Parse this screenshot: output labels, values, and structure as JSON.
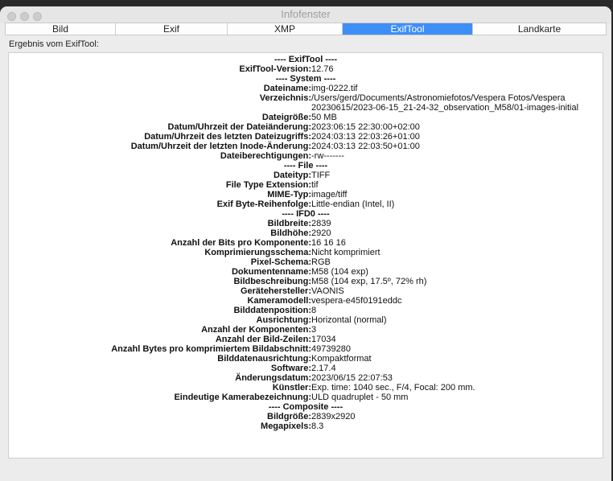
{
  "window": {
    "title": "Infofenster"
  },
  "tabs": [
    {
      "label": "Bild",
      "active": false
    },
    {
      "label": "Exif",
      "active": false
    },
    {
      "label": "XMP",
      "active": false
    },
    {
      "label": "ExifTool",
      "active": true
    },
    {
      "label": "Landkarte",
      "active": false
    }
  ],
  "panel": {
    "label": "Ergebnis vom ExifTool:"
  },
  "colors": {
    "accent": "#3d8ef7"
  },
  "rows": [
    {
      "section": "---- ExifTool ----"
    },
    {
      "key": "ExifTool-Version:",
      "value": "12.76"
    },
    {
      "section": "---- System ----"
    },
    {
      "key": "Dateiname:",
      "value": "img-0222.tif"
    },
    {
      "key": "Verzeichnis:",
      "value": "/Users/gerd/Documents/Astronomiefotos/Vespera Fotos/Vespera"
    },
    {
      "cont": "20230615/2023-06-15_21-24-32_observation_M58/01-images-initial"
    },
    {
      "key": "Dateigröße:",
      "value": "50 MB"
    },
    {
      "key": "Datum/Uhrzeit der Dateiänderung:",
      "value": "2023:06:15 22:30:00+02:00"
    },
    {
      "key": "Datum/Uhrzeit des letzten Dateizugriffs:",
      "value": "2024:03:13 22:03:26+01:00"
    },
    {
      "key": "Datum/Uhrzeit der letzten Inode-Änderung:",
      "value": "2024:03:13 22:03:50+01:00"
    },
    {
      "key": "Dateiberechtigungen:",
      "value": "-rw-------"
    },
    {
      "section": "---- File ----"
    },
    {
      "key": "Dateityp:",
      "value": "TIFF"
    },
    {
      "key": "File Type Extension:",
      "value": "tif"
    },
    {
      "key": "MIME-Typ:",
      "value": "image/tiff"
    },
    {
      "key": "Exif Byte-Reihenfolge:",
      "value": "Little-endian (Intel, II)"
    },
    {
      "section": "---- IFD0 ----"
    },
    {
      "key": "Bildbreite:",
      "value": "2839"
    },
    {
      "key": "Bildhöhe:",
      "value": "2920"
    },
    {
      "key": "Anzahl der Bits pro Komponente:",
      "value": "16 16 16"
    },
    {
      "key": "Komprimierungsschema:",
      "value": "Nicht komprimiert"
    },
    {
      "key": "Pixel-Schema:",
      "value": "RGB"
    },
    {
      "key": "Dokumentenname:",
      "value": "M58 (104 exp)"
    },
    {
      "key": "Bildbeschreibung:",
      "value": "M58 (104 exp, 17.5º, 72% rh)"
    },
    {
      "key": "Gerätehersteller:",
      "value": "VAONIS"
    },
    {
      "key": "Kameramodell:",
      "value": "vespera-e45f0191eddc"
    },
    {
      "key": "Bilddatenposition:",
      "value": "8"
    },
    {
      "key": "Ausrichtung:",
      "value": "Horizontal (normal)"
    },
    {
      "key": "Anzahl der Komponenten:",
      "value": "3"
    },
    {
      "key": "Anzahl der Bild-Zeilen:",
      "value": "17034"
    },
    {
      "key": "Anzahl Bytes pro komprimiertem Bildabschnitt:",
      "value": "49739280"
    },
    {
      "key": "Bilddatenausrichtung:",
      "value": "Kompaktformat"
    },
    {
      "key": "Software:",
      "value": "2.17.4"
    },
    {
      "key": "Änderungsdatum:",
      "value": "2023/06/15 22:07:53"
    },
    {
      "key": "Künstler:",
      "value": "Exp. time: 1040 sec., F/4, Focal: 200 mm."
    },
    {
      "key": "Eindeutige Kamerabezeichnung:",
      "value": "ULD quadruplet - 50 mm"
    },
    {
      "section": "---- Composite ----"
    },
    {
      "key": "Bildgröße:",
      "value": "2839x2920"
    },
    {
      "key": "Megapixels:",
      "value": "8.3"
    }
  ]
}
